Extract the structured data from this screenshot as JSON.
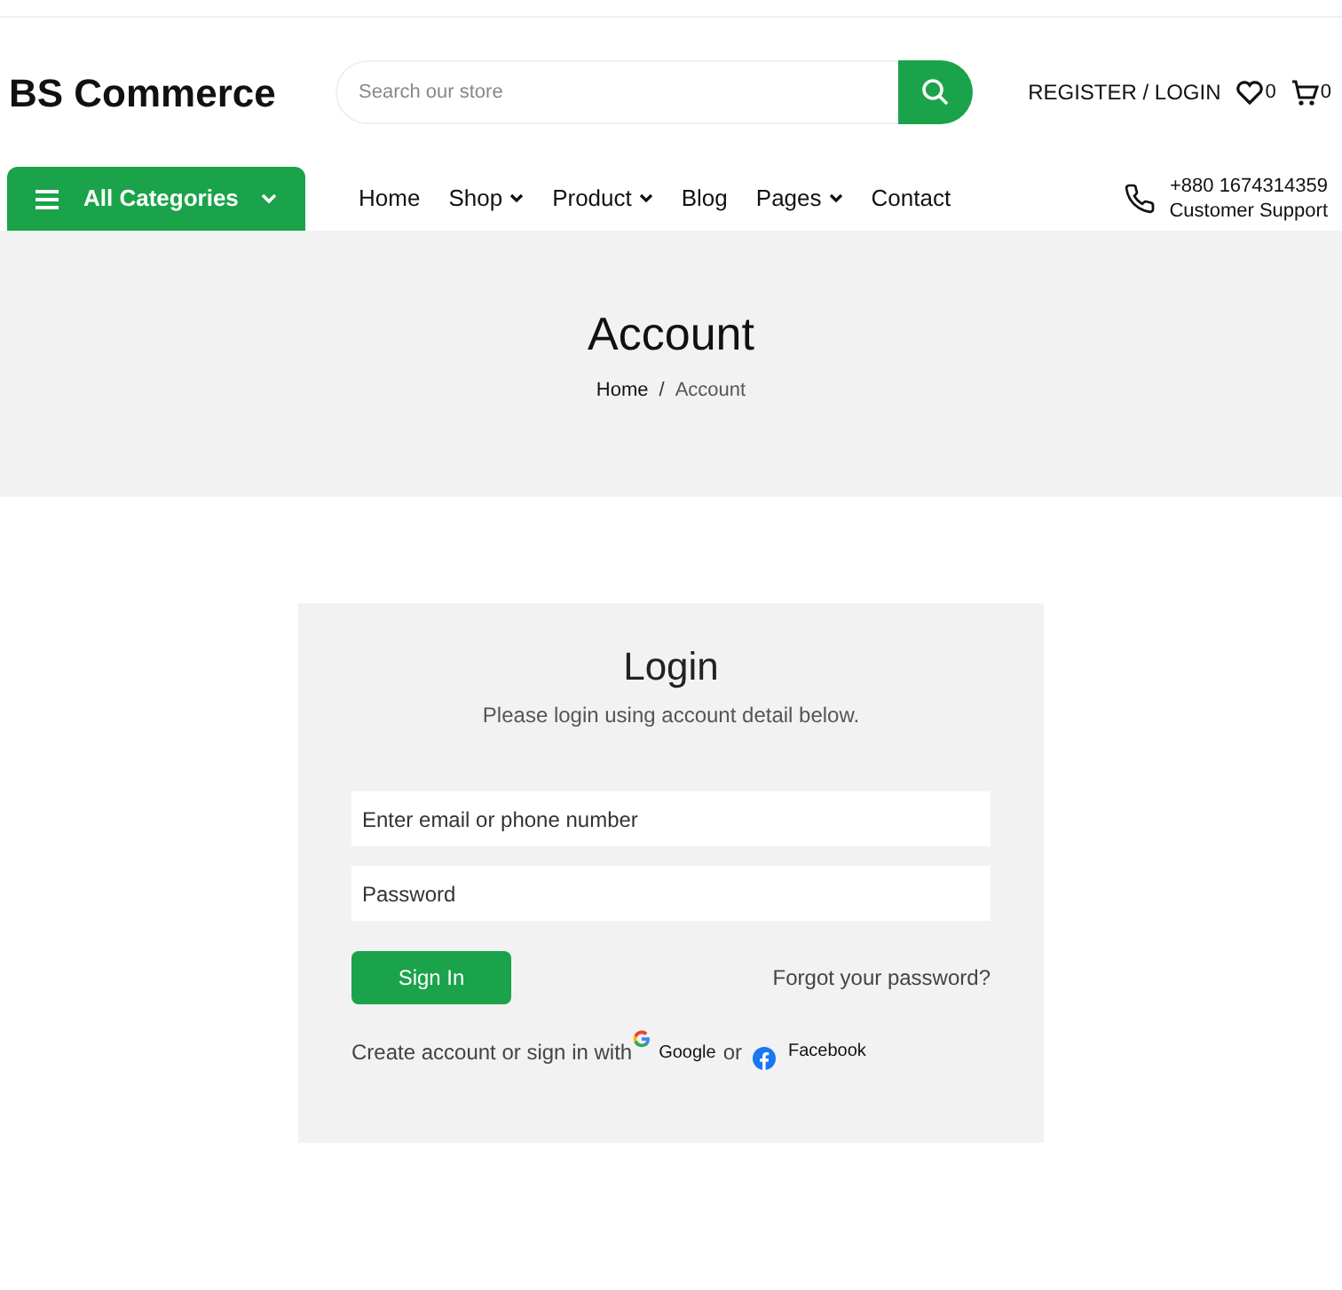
{
  "header": {
    "logo": "BS Commerce",
    "search": {
      "placeholder": "Search our store"
    },
    "account_link": "REGISTER / LOGIN",
    "wishlist_count": "0",
    "cart_count": "0"
  },
  "nav": {
    "categories_button": "All Categories",
    "items": [
      {
        "label": "Home",
        "has_dropdown": false
      },
      {
        "label": "Shop",
        "has_dropdown": true
      },
      {
        "label": "Product",
        "has_dropdown": true
      },
      {
        "label": "Blog",
        "has_dropdown": false
      },
      {
        "label": "Pages",
        "has_dropdown": true
      },
      {
        "label": "Contact",
        "has_dropdown": false
      }
    ],
    "phone": "+880 1674314359",
    "support_label": "Customer Support"
  },
  "banner": {
    "title": "Account",
    "breadcrumb": [
      "Home",
      "Account"
    ],
    "breadcrumb_separator": "/"
  },
  "login": {
    "title": "Login",
    "subtitle": "Please login using account detail below.",
    "email": {
      "placeholder": "Enter email or phone number"
    },
    "password": {
      "placeholder": "Password"
    },
    "submit": "Sign In",
    "forgot": "Forgot your password?",
    "social_prefix": "Create account or sign in with",
    "google": "Google",
    "or": "or",
    "facebook": "Facebook"
  }
}
